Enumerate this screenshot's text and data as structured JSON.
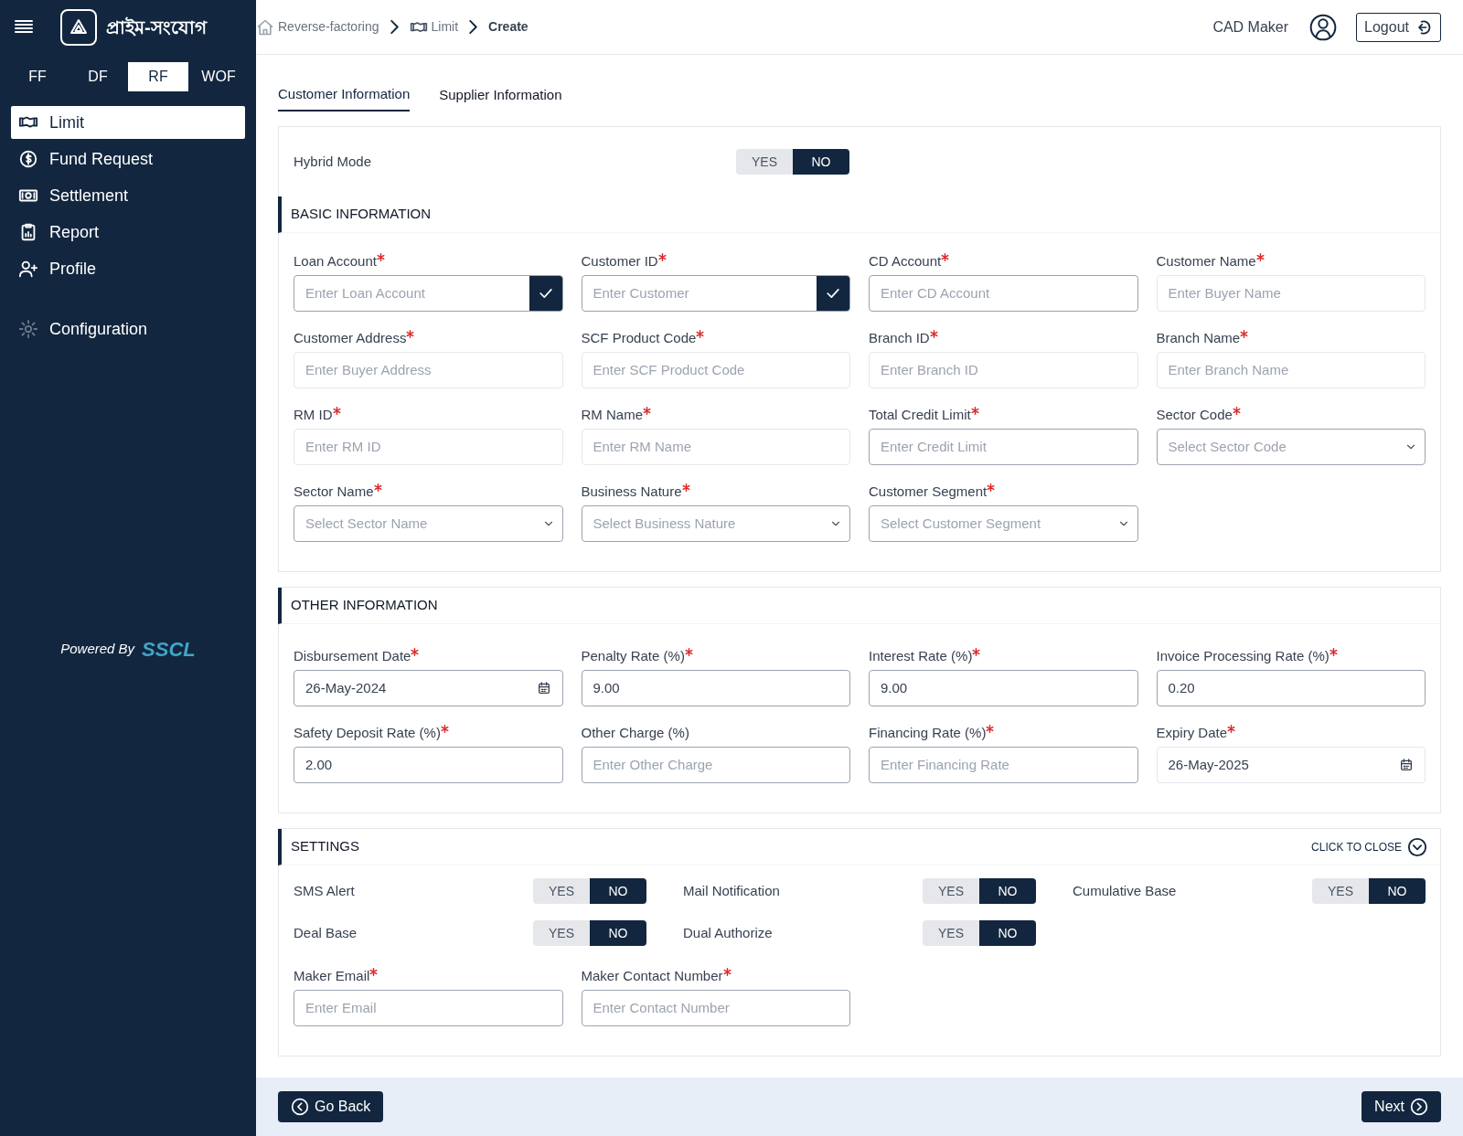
{
  "sidebar": {
    "logo_text": "প্রাইম-সংযোগ",
    "segments": [
      {
        "label": "FF",
        "selected": false
      },
      {
        "label": "DF",
        "selected": false
      },
      {
        "label": "RF",
        "selected": true
      },
      {
        "label": "WOF",
        "selected": false
      }
    ],
    "items": [
      {
        "label": "Limit",
        "selected": true
      },
      {
        "label": "Fund Request",
        "selected": false
      },
      {
        "label": "Settlement",
        "selected": false
      },
      {
        "label": "Report",
        "selected": false
      },
      {
        "label": "Profile",
        "selected": false
      }
    ],
    "config_item": {
      "label": "Configuration"
    },
    "powered_by": {
      "label": "Powered By",
      "brand": "SSCL"
    }
  },
  "breadcrumb": [
    "Reverse-factoring",
    "Limit",
    "Create"
  ],
  "header": {
    "user": "CAD Maker",
    "logout": "Logout"
  },
  "tabs": [
    {
      "label": "Customer Information",
      "selected": true
    },
    {
      "label": "Supplier Information",
      "selected": false
    }
  ],
  "hybrid_mode": {
    "label": "Hybrid Mode",
    "options": [
      {
        "label": "YES",
        "selected": false
      },
      {
        "label": "NO",
        "selected": true
      }
    ]
  },
  "sections": [
    {
      "title": "BASIC INFORMATION",
      "fields": [
        {
          "kind": "check",
          "label": "Loan Account",
          "required": true,
          "placeholder": "Enter Loan Account"
        },
        {
          "kind": "check",
          "label": "Customer ID",
          "required": true,
          "placeholder": "Enter Customer"
        },
        {
          "kind": "text",
          "label": "CD Account",
          "required": true,
          "placeholder": "Enter CD Account"
        },
        {
          "kind": "readonly",
          "label": "Customer Name",
          "required": true,
          "placeholder": "Enter Buyer Name"
        },
        {
          "kind": "readonly",
          "label": "Customer Address",
          "required": true,
          "placeholder": "Enter Buyer Address"
        },
        {
          "kind": "readonly",
          "label": "SCF Product Code",
          "required": true,
          "placeholder": "Enter SCF Product Code"
        },
        {
          "kind": "readonly",
          "label": "Branch ID",
          "required": true,
          "placeholder": "Enter Branch ID"
        },
        {
          "kind": "readonly",
          "label": "Branch Name",
          "required": true,
          "placeholder": "Enter Branch Name"
        },
        {
          "kind": "readonly",
          "label": "RM ID",
          "required": true,
          "placeholder": "Enter RM ID"
        },
        {
          "kind": "readonly",
          "label": "RM Name",
          "required": true,
          "placeholder": "Enter RM Name"
        },
        {
          "kind": "text",
          "label": "Total Credit Limit",
          "required": true,
          "placeholder": "Enter Credit Limit"
        },
        {
          "kind": "select",
          "label": "Sector Code",
          "required": true,
          "placeholder": "Select Sector Code"
        },
        {
          "kind": "select",
          "label": "Sector Name",
          "required": true,
          "placeholder": "Select Sector Name"
        },
        {
          "kind": "select",
          "label": "Business Nature",
          "required": true,
          "placeholder": "Select Business Nature"
        },
        {
          "kind": "select",
          "label": "Customer Segment",
          "required": true,
          "placeholder": "Select Customer Segment"
        }
      ]
    },
    {
      "title": "OTHER INFORMATION",
      "fields": [
        {
          "kind": "date",
          "label": "Disbursement Date",
          "required": true,
          "value": "26-May-2024"
        },
        {
          "kind": "text",
          "label": "Penalty Rate (%)",
          "required": true,
          "value": "9.00"
        },
        {
          "kind": "text",
          "label": "Interest Rate (%)",
          "required": true,
          "value": "9.00"
        },
        {
          "kind": "text",
          "label": "Invoice Processing Rate (%)",
          "required": true,
          "value": "0.20"
        },
        {
          "kind": "text",
          "label": "Safety Deposit Rate (%)",
          "required": true,
          "value": "2.00"
        },
        {
          "kind": "text",
          "label": "Other Charge (%)",
          "required": false,
          "placeholder": "Enter Other Charge"
        },
        {
          "kind": "text",
          "label": "Financing Rate (%)",
          "required": true,
          "placeholder": "Enter Financing Rate"
        },
        {
          "kind": "readonly-date",
          "label": "Expiry Date",
          "required": true,
          "value": "26-May-2025"
        }
      ]
    },
    {
      "title": "SETTINGS",
      "close_label": "CLICK TO CLOSE",
      "toggles": [
        {
          "label": "SMS Alert",
          "options": [
            {
              "label": "YES",
              "selected": false
            },
            {
              "label": "NO",
              "selected": true
            }
          ]
        },
        {
          "label": "Mail Notification",
          "options": [
            {
              "label": "YES",
              "selected": false
            },
            {
              "label": "NO",
              "selected": true
            }
          ]
        },
        {
          "label": "Cumulative Base",
          "options": [
            {
              "label": "YES",
              "selected": false
            },
            {
              "label": "NO",
              "selected": true
            }
          ]
        },
        {
          "label": "Deal Base",
          "options": [
            {
              "label": "YES",
              "selected": false
            },
            {
              "label": "NO",
              "selected": true
            }
          ]
        },
        {
          "label": "Dual Authorize",
          "options": [
            {
              "label": "YES",
              "selected": false
            },
            {
              "label": "NO",
              "selected": true
            }
          ]
        }
      ],
      "fields": [
        {
          "kind": "text",
          "label": "Maker Email",
          "required": true,
          "placeholder": "Enter Email"
        },
        {
          "kind": "text",
          "label": "Maker Contact Number",
          "required": true,
          "placeholder": "Enter Contact Number"
        }
      ]
    }
  ],
  "footer": {
    "back": "Go Back",
    "next": "Next"
  }
}
